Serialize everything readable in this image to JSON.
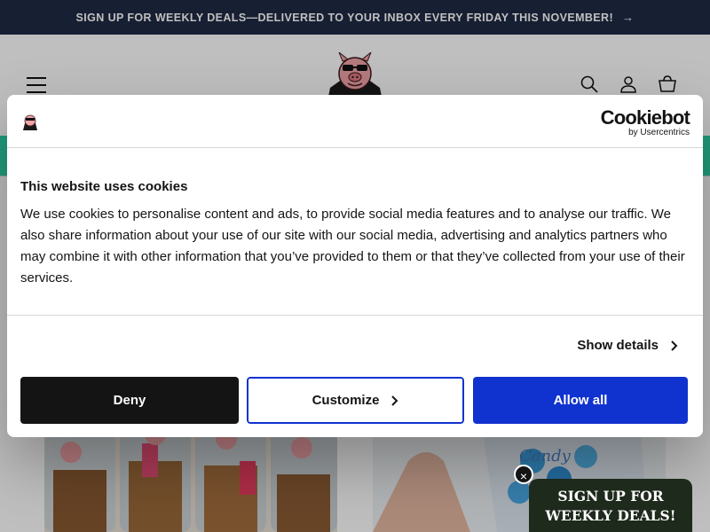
{
  "announcement": {
    "text": "SIGN UP FOR WEEKLY DEALS—DELIVERED TO YOUR INBOX EVERY FRIDAY THIS NOVEMBER!",
    "arrow": "→"
  },
  "header": {
    "icons": [
      "menu-icon",
      "search-icon",
      "account-icon",
      "cart-icon"
    ]
  },
  "cookie_dialog": {
    "brand": "Cookiebot",
    "brand_sub": "by Usercentrics",
    "title": "This website uses cookies",
    "body": "We use cookies to personalise content and ads, to provide social media features and to analyse our traffic. We also share information about your use of our site with our social media, advertising and analytics partners who may combine it with other information that you’ve provided to them or that they’ve collected from your use of their services.",
    "show_details": "Show details",
    "buttons": {
      "deny": "Deny",
      "customize": "Customize",
      "allow": "Allow all"
    },
    "colors": {
      "primary": "#1032cf",
      "dark": "#141414"
    }
  },
  "deals_popup": {
    "line1": "SIGN UP FOR",
    "line2": "WEEKLY DEALS!",
    "close": "×"
  },
  "products": [
    {
      "image_label": "Candy"
    }
  ],
  "colors": {
    "announcement_bg": "#1f2a44",
    "strip": "#2ed1a4"
  }
}
